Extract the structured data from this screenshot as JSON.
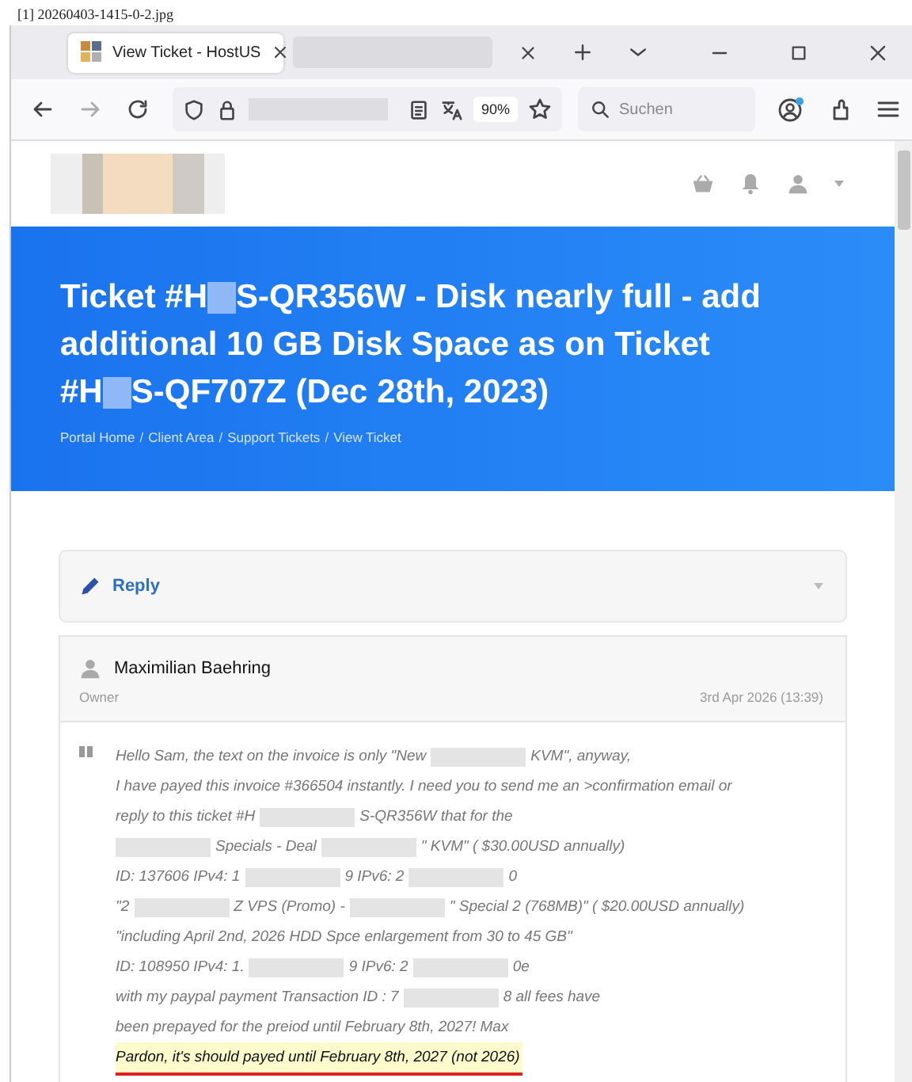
{
  "caption": "[1] 20260403-1415-0-2.jpg",
  "browser": {
    "tabs": [
      {
        "kind": "page",
        "title": "View Ticket - HostUS",
        "selected": true
      },
      {
        "kind": "redacted",
        "selected": false
      }
    ],
    "zoom": "90%",
    "search": {
      "placeholder": "Suchen"
    }
  },
  "page": {
    "title_lines": [
      [
        {
          "kind": "text",
          "text": "Ticket #H"
        },
        {
          "kind": "redacted"
        },
        {
          "kind": "text",
          "text": "S-QR356W - Disk nearly full - add"
        }
      ],
      [
        {
          "kind": "text",
          "text": "additional 10 GB Disk Space as on Ticket"
        }
      ],
      [
        {
          "kind": "text",
          "text": "#H"
        },
        {
          "kind": "redacted"
        },
        {
          "kind": "text",
          "text": "S-QF707Z (Dec 28th, 2023)"
        }
      ]
    ],
    "breadcrumb": [
      "Portal Home",
      "Client Area",
      "Support Tickets",
      "View Ticket"
    ],
    "breadcrumb_separator": "/",
    "reply": {
      "label": "Reply",
      "expanded": false
    },
    "message": {
      "author": "Maximilian Baehring",
      "role": "Owner",
      "date": "3rd Apr 2026 (13:39)",
      "lines": [
        {
          "highlighted": false,
          "parts": [
            {
              "kind": "text",
              "text": "Hello Sam, the text on the invoice is only \"New"
            },
            {
              "kind": "redacted"
            },
            {
              "kind": "text",
              "text": "KVM\", anyway,"
            }
          ]
        },
        {
          "highlighted": false,
          "parts": [
            {
              "kind": "text",
              "text": "I have payed this invoice #366504 instantly. I need you to send me an >confirmation email or"
            }
          ]
        },
        {
          "highlighted": false,
          "parts": [
            {
              "kind": "text",
              "text": "reply to this ticket #H"
            },
            {
              "kind": "redacted"
            },
            {
              "kind": "text",
              "text": "S-QR356W that for the"
            }
          ]
        },
        {
          "highlighted": false,
          "parts": [
            {
              "kind": "redacted"
            },
            {
              "kind": "text",
              "text": "Specials - Deal"
            },
            {
              "kind": "redacted"
            },
            {
              "kind": "text",
              "text": "\" KVM\" ( $30.00USD annually)"
            }
          ]
        },
        {
          "highlighted": false,
          "parts": [
            {
              "kind": "text",
              "text": "ID: 137606 IPv4: 1"
            },
            {
              "kind": "redacted"
            },
            {
              "kind": "text",
              "text": "9 IPv6: 2"
            },
            {
              "kind": "redacted"
            },
            {
              "kind": "text",
              "text": "0"
            }
          ]
        },
        {
          "highlighted": false,
          "parts": [
            {
              "kind": "text",
              "text": "\"2"
            },
            {
              "kind": "redacted"
            },
            {
              "kind": "text",
              "text": "Z VPS (Promo) -"
            },
            {
              "kind": "redacted"
            },
            {
              "kind": "text",
              "text": "\" Special 2 (768MB)\" ( $20.00USD annually)"
            }
          ]
        },
        {
          "highlighted": false,
          "parts": [
            {
              "kind": "text",
              "text": "\"including April 2nd, 2026 HDD Spce enlargement from 30 to 45 GB\""
            }
          ]
        },
        {
          "highlighted": false,
          "parts": [
            {
              "kind": "text",
              "text": "ID: 108950 IPv4: 1."
            },
            {
              "kind": "redacted"
            },
            {
              "kind": "text",
              "text": "9 IPv6: 2"
            },
            {
              "kind": "redacted"
            },
            {
              "kind": "text",
              "text": "0e"
            }
          ]
        },
        {
          "highlighted": false,
          "parts": [
            {
              "kind": "text",
              "text": "with my paypal payment Transaction ID : 7"
            },
            {
              "kind": "redacted"
            },
            {
              "kind": "text",
              "text": "8 all fees have"
            }
          ]
        },
        {
          "highlighted": false,
          "parts": [
            {
              "kind": "text",
              "text": "been prepayed for the preiod until February 8th, 2027! Max"
            }
          ]
        },
        {
          "highlighted": true,
          "parts": [
            {
              "kind": "text",
              "text": "Pardon, it's should payed until February 8th, 2027 (not 2026)"
            }
          ]
        }
      ]
    }
  }
}
